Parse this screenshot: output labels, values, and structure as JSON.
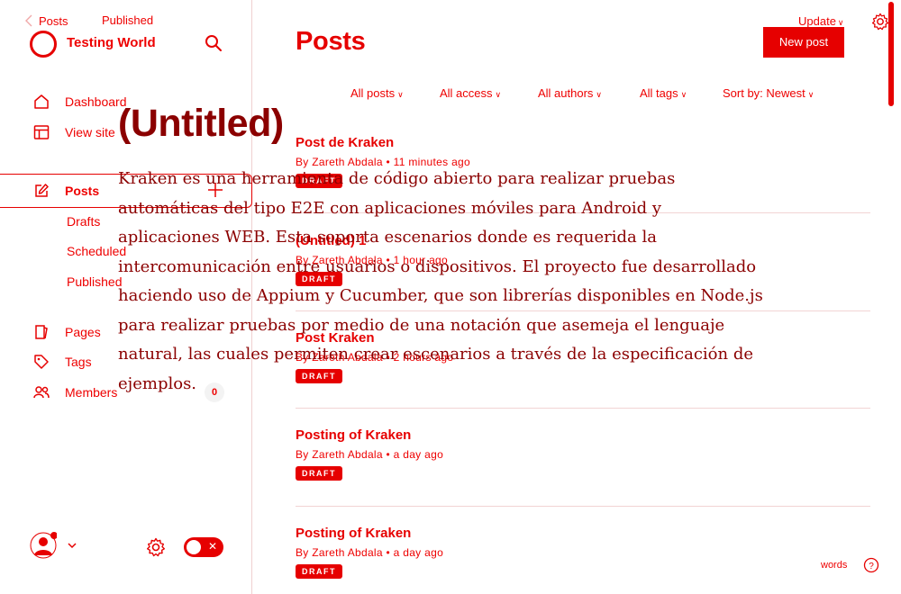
{
  "editor": {
    "breadcrumb_posts": "Posts",
    "status": "Published",
    "update_label": "Update"
  },
  "sidebar": {
    "brand": "Testing World",
    "nav": {
      "dashboard": "Dashboard",
      "view_site": "View site",
      "posts": "Posts",
      "drafts": "Drafts",
      "scheduled": "Scheduled",
      "published": "Published",
      "pages": "Pages",
      "tags": "Tags",
      "members": "Members",
      "members_count": "0"
    }
  },
  "main": {
    "title": "Posts",
    "new_post": "New post",
    "filters": {
      "all_posts": "All posts",
      "all_access": "All access",
      "all_authors": "All authors",
      "all_tags": "All tags",
      "sort": "Sort by: Newest"
    },
    "posts": [
      {
        "title": "Post de Kraken",
        "meta": "By Zareth Abdala • 11 minutes ago",
        "status": "DRAFT"
      },
      {
        "title": "(Untitled) 1",
        "meta": "By Zareth Abdala • 1 hour ago",
        "status": "DRAFT"
      },
      {
        "title": "Post Kraken",
        "meta": "By Zareth Abdala • 2 hours ago",
        "status": "DRAFT"
      },
      {
        "title": "Posting of Kraken",
        "meta": "By Zareth Abdala • a day ago",
        "status": "DRAFT"
      },
      {
        "title": "Posting of Kraken",
        "meta": "By Zareth Abdala • a day ago",
        "status": "DRAFT"
      }
    ]
  },
  "footer": {
    "words": "words"
  },
  "overlay": {
    "title": "(Untitled)",
    "body": "Kraken es una herramienta de código abierto para realizar pruebas automáticas del tipo E2E con aplicaciones móviles para Android y aplicaciones WEB. Esta soporta escenarios donde es requerida la intercomunicación entre usuarios o dispositivos. El proyecto fue desarrollado haciendo uso de Appium y Cucumber, que son librerías disponibles en Node.js para realizar pruebas por medio de una notación que asemeja el lenguaje natural, las cuales permiten crear escenarios a través de la especificación de ejemplos."
  },
  "colors": {
    "accent": "#e60000",
    "overlay_text": "#8b0000"
  }
}
